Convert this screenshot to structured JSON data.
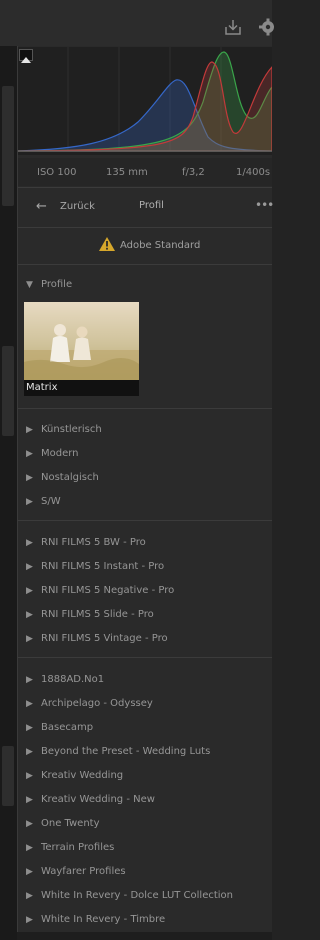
{
  "exif": {
    "iso": "ISO 100",
    "focal": "135 mm",
    "aperture": "f/3,2",
    "shutter": "1/400s"
  },
  "nav": {
    "back_label": "Zurück",
    "title": "Profil",
    "more": "•••"
  },
  "warning": {
    "label": "Adobe Standard"
  },
  "profile_section": {
    "header": "Profile",
    "thumbnail_label": "Matrix"
  },
  "groups": [
    [
      "Künstlerisch",
      "Modern",
      "Nostalgisch",
      "S/W"
    ],
    [
      "RNI FILMS 5 BW - Pro",
      "RNI FILMS 5 Instant - Pro",
      "RNI FILMS 5 Negative - Pro",
      "RNI FILMS 5 Slide - Pro",
      "RNI FILMS 5 Vintage - Pro"
    ],
    [
      "1888AD.No1",
      "Archipelago - Odyssey",
      "Basecamp",
      "Beyond the Preset - Wedding Luts",
      "Kreativ Wedding",
      "Kreativ Wedding - New",
      "One Twenty",
      "Terrain Profiles",
      "Wayfarer Profiles",
      "White In Revery - Dolce LUT Collection",
      "White In Revery - Timbre"
    ]
  ],
  "icons": {
    "download": "download-icon",
    "settings": "gear-icon",
    "warning": "warning-icon",
    "back": "back-arrow-icon",
    "expand": "triangle-right-icon",
    "collapse": "triangle-down-icon"
  },
  "colors": {
    "warning": "#d6a72b",
    "hist_red": "#c23a3a",
    "hist_green": "#3aa54a",
    "hist_blue": "#3567c8"
  }
}
